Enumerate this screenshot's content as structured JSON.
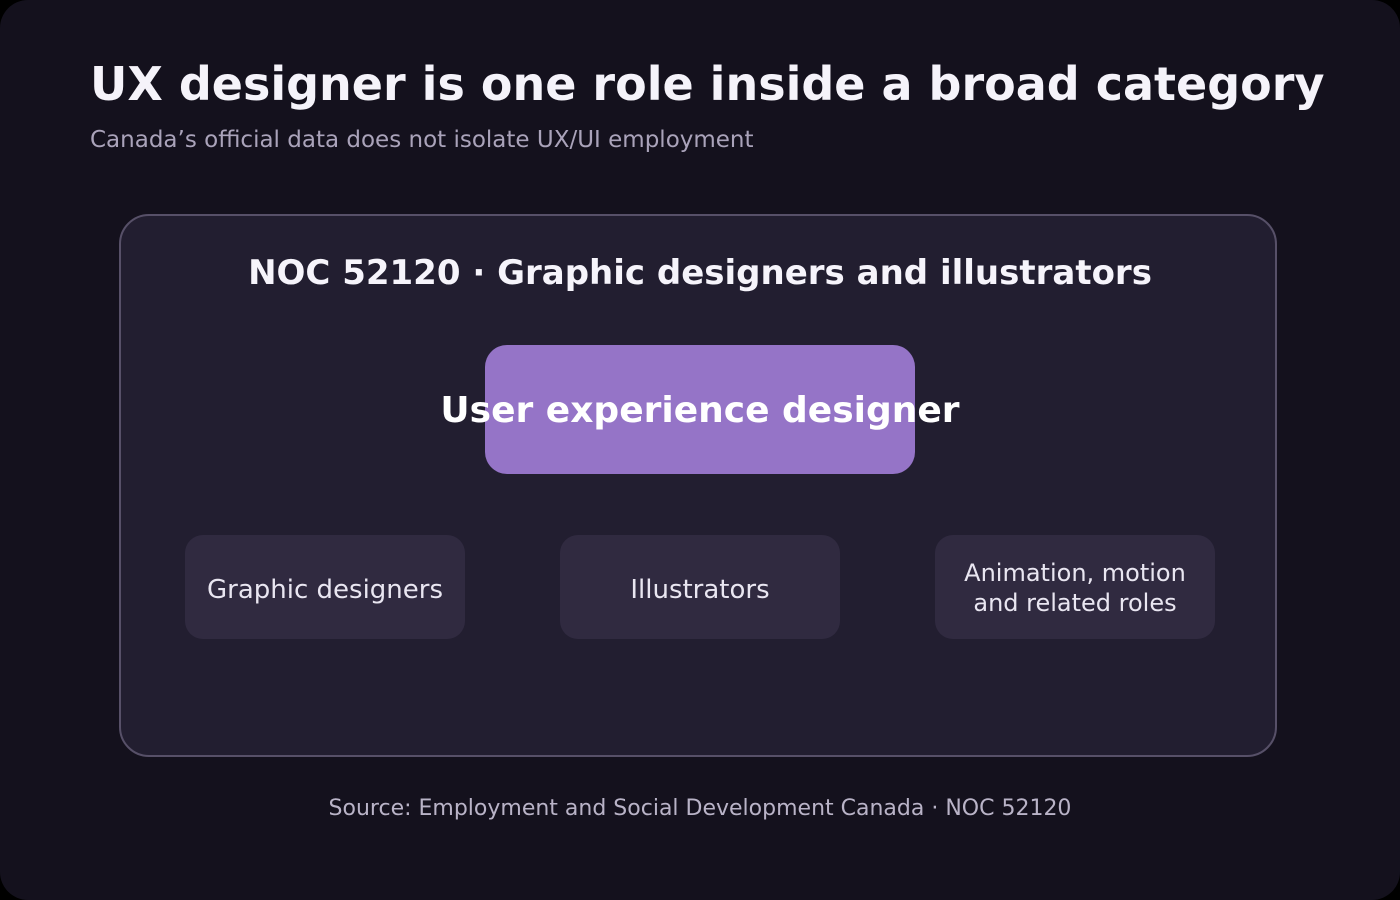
{
  "header": {
    "title": "UX designer is one role inside a broad category",
    "subtitle": "Canada’s official data does not isolate UX/UI employment"
  },
  "category": {
    "title": "NOC 52120 · Graphic designers and illustrators",
    "highlight_role": "User experience designer",
    "roles": [
      {
        "label": "Graphic designers"
      },
      {
        "label": "Illustrators"
      },
      {
        "label": "Animation, motion and related roles"
      }
    ]
  },
  "footer": {
    "source": "Source: Employment and Social Development Canada · NOC 52120"
  },
  "colors": {
    "background": "#14111d",
    "category_fill": "#221e30",
    "category_border": "#575068",
    "highlight": "#9574c7",
    "role_fill": "#302a40"
  }
}
